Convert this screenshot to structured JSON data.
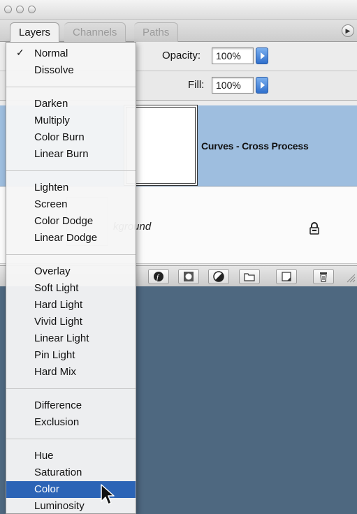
{
  "tabs": [
    {
      "label": "Layers",
      "active": true
    },
    {
      "label": "Channels",
      "active": false
    },
    {
      "label": "Paths",
      "active": false
    }
  ],
  "opacity": {
    "label": "Opacity:",
    "value": "100%"
  },
  "fill": {
    "label": "Fill:",
    "value": "100%"
  },
  "layers": [
    {
      "name": "Curves - Cross Process",
      "selected": true
    },
    {
      "name": "kground",
      "locked": true
    }
  ],
  "blend_menu": {
    "selected": "Normal",
    "highlighted": "Color",
    "groups": [
      [
        "Normal",
        "Dissolve"
      ],
      [
        "Darken",
        "Multiply",
        "Color Burn",
        "Linear Burn"
      ],
      [
        "Lighten",
        "Screen",
        "Color Dodge",
        "Linear Dodge"
      ],
      [
        "Overlay",
        "Soft Light",
        "Hard Light",
        "Vivid Light",
        "Linear Light",
        "Pin Light",
        "Hard Mix"
      ],
      [
        "Difference",
        "Exclusion"
      ],
      [
        "Hue",
        "Saturation",
        "Color",
        "Luminosity"
      ]
    ]
  },
  "bottom_toolbar": [
    {
      "icon": "layer-style-icon"
    },
    {
      "icon": "layer-mask-icon"
    },
    {
      "icon": "adjustment-layer-icon"
    },
    {
      "icon": "new-group-icon"
    },
    {
      "icon": "new-layer-icon"
    },
    {
      "icon": "trash-icon"
    }
  ],
  "colors": {
    "selected_layer": "#9ebedf",
    "menu_highlight": "#2c64b6",
    "background": "#4e6880",
    "accent_arrow": "#2f6fcc"
  }
}
